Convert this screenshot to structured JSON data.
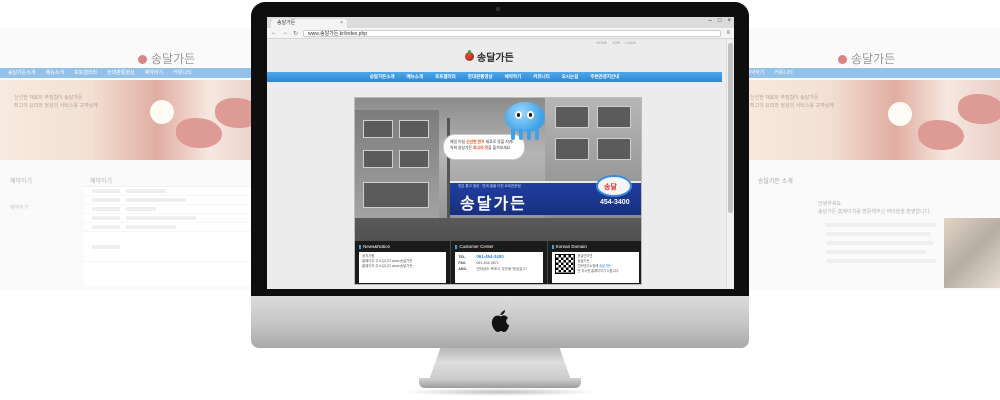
{
  "background": {
    "left": {
      "logo": "송달가든",
      "nav": [
        "송달가든소개",
        "메뉴소개",
        "포토갤러리",
        "현대판통영상",
        "예약하기",
        "커뮤니티"
      ],
      "banner_text": [
        "신선한 재료와 푸짐함이 송달가든",
        "최고의 요리와 정성의 서비스를 고객님께"
      ],
      "sidebar_title": "예약하기",
      "content_title": "예약하기",
      "side_label": "예약하기"
    },
    "right": {
      "logo": "송달가든",
      "nav": [
        "예약하기",
        "커뮤니티"
      ],
      "banner_text": [
        "신선한 재료와 푸짐함이 송달가든",
        "최고의 요리와 정성의 서비스를 고객님께"
      ],
      "content_title": "송달가든 소개",
      "greeting": "안녕하세요.",
      "intro": "송달가든 홈페이지를 방문해주신 여러분을 환영합니다."
    }
  },
  "browser": {
    "tab_title": "송달가든",
    "address": "www.송달가든.kr/index.php",
    "window_controls": [
      "–",
      "□",
      "×"
    ]
  },
  "site": {
    "logo": "송달가든",
    "top_links": [
      "HOME",
      "JOIN",
      "LOGIN"
    ],
    "nav": [
      "송달가든소개",
      "메뉴소개",
      "포토갤러리",
      "현대판통영상",
      "예약하기",
      "커뮤니티",
      "오시는길",
      "주변관광지안내"
    ],
    "hero": {
      "speech_line1_pre": "매일 아침 ",
      "speech_line1_hl": "신선한 한우",
      "speech_line1_post": " 재료로 맛을 지켜!",
      "speech_line2_pre": "저희 송달가든 ",
      "speech_line2_hl": "최고의 맛",
      "speech_line2_post": "을 즐겨보세요.",
      "sign_top": "맛은 좋고 정성 · 맛과 쉴을 다진 요리전문점",
      "sign_name": "송달가든",
      "sign_badge": "송달",
      "sign_phone": "454-3400"
    },
    "news": {
      "title": "News&Notice",
      "items": [
        "공지사항",
        "홈페이지 주소입니다 www.송달가든.",
        "홈페이지 주소입니다 www.송달가든."
      ]
    },
    "customer": {
      "title": "Customer Center",
      "rows": [
        {
          "label": "TEL.",
          "value": "061-454-3400"
        },
        {
          "label": "FAX.",
          "value": "061-454-9871"
        },
        {
          "label": "ADD.",
          "value": "전라남도 목포시 무안동 명성길 27"
        }
      ]
    },
    "domain": {
      "title": "Korean Domain",
      "line1": "한글인터넷",
      "line2": "송달가든",
      "line3": "인터넷주소창에 ",
      "line3_hl": "송달가든",
      "line4": "만 치시면 홈페이지가 나옵니다"
    }
  }
}
